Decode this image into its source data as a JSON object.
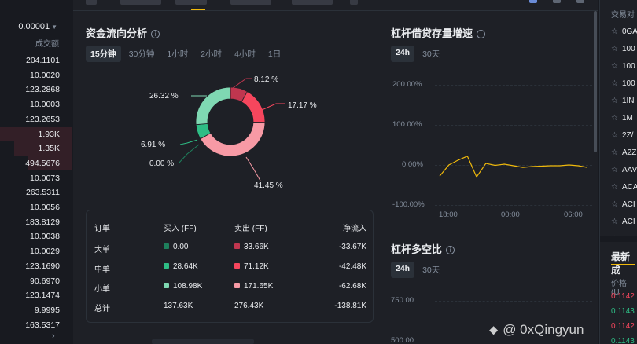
{
  "order_book": {
    "precision": "0.00001",
    "volume_label": "成交额",
    "rows": [
      "204.1101",
      "10.0020",
      "123.2868",
      "10.0003",
      "123.2653",
      "1.93K",
      "1.35K",
      "494.5676",
      "10.0073",
      "263.5311",
      "10.0056",
      "183.8129",
      "10.0038",
      "10.0029",
      "123.1690",
      "90.6970",
      "123.1474",
      "9.9995",
      "163.5317"
    ],
    "fill_fraction": [
      0.0,
      0.0,
      0.0,
      0.0,
      0.0,
      1.0,
      0.8,
      0.62,
      0.0,
      0.0,
      0.0,
      0.0,
      0.0,
      0.0,
      0.0,
      0.0,
      0.0,
      0.0,
      0.0
    ]
  },
  "fund_flow": {
    "title": "资金流向分析",
    "tabs": [
      "15分钟",
      "30分钟",
      "1小时",
      "2小时",
      "4小时",
      "1日"
    ],
    "active_tab": "15分钟",
    "donut_labels": {
      "left_top": "26.32 %",
      "top_right": "8.12 %",
      "right": "17.17 %",
      "left_mid": "6.91 %",
      "left_low": "0.00 %",
      "bottom_right": "41.45 %"
    },
    "segments": [
      {
        "name": "大单卖出",
        "value": 8.12,
        "color": "#c0364f"
      },
      {
        "name": "中单卖出",
        "value": 17.17,
        "color": "#f6465d"
      },
      {
        "name": "小单卖出",
        "value": 41.45,
        "color": "#f79aa5"
      },
      {
        "name": "大单买入",
        "value": 0.0,
        "color": "#1e7f5c"
      },
      {
        "name": "中单买入",
        "value": 6.91,
        "color": "#2ebd85"
      },
      {
        "name": "小单买入",
        "value": 26.32,
        "color": "#7fd8b2"
      }
    ],
    "table": {
      "headers": [
        "订单",
        "买入 (FF)",
        "卖出 (FF)",
        "净流入"
      ],
      "rows": [
        {
          "label": "大单",
          "buy": "0.00",
          "sell": "33.66K",
          "net": "-33.67K",
          "buy_color": "#1e7f5c",
          "sell_color": "#c0364f"
        },
        {
          "label": "中单",
          "buy": "28.64K",
          "sell": "71.12K",
          "net": "-42.48K",
          "buy_color": "#2ebd85",
          "sell_color": "#f6465d"
        },
        {
          "label": "小单",
          "buy": "108.98K",
          "sell": "171.65K",
          "net": "-62.68K",
          "buy_color": "#7fd8b2",
          "sell_color": "#f79aa5"
        },
        {
          "label": "总计",
          "buy": "137.63K",
          "sell": "276.43K",
          "net": "-138.81K"
        }
      ]
    }
  },
  "leverage_growth": {
    "title": "杠杆借贷存量增速",
    "tabs": [
      "24h",
      "30天"
    ],
    "active_tab": "24h",
    "y_ticks": [
      "200.00%",
      "100.00%",
      "0.00%",
      "-100.00%"
    ],
    "x_ticks": [
      "18:00",
      "00:00",
      "06:00"
    ]
  },
  "long_short": {
    "title": "杠杆多空比",
    "tabs": [
      "24h",
      "30天"
    ],
    "active_tab": "24h",
    "y_ticks": [
      "750.00",
      "500.00"
    ]
  },
  "chart_data": {
    "type": "line",
    "title": "杠杆借贷存量增速",
    "x_ticks": [
      "18:00",
      "00:00",
      "06:00"
    ],
    "ylim": [
      -100,
      200
    ],
    "y_ticks": [
      200,
      100,
      0,
      -100
    ],
    "values": [
      -28,
      0,
      12,
      22,
      -30,
      4,
      -1,
      2,
      -2,
      -6,
      -4,
      -3,
      -2,
      -2,
      0,
      -2,
      -6
    ],
    "line_color": "#f0b90b",
    "grid": true
  },
  "market_list": {
    "header": "交易对",
    "items": [
      "0GA",
      "100",
      "100",
      "100",
      "1IN",
      "1M",
      "2Z/",
      "A2Z",
      "AAV",
      "ACA",
      "ACI",
      "ACI",
      "ACI"
    ],
    "latest_title": "最新成",
    "price_label": "价格 (U",
    "prices": [
      {
        "value": "0.1142",
        "color": "#f6465d"
      },
      {
        "value": "0.1143",
        "color": "#2ebd85"
      },
      {
        "value": "0.1142",
        "color": "#f6465d"
      },
      {
        "value": "0.1143",
        "color": "#2ebd85"
      }
    ]
  },
  "watermark": {
    "text": "@ 0xQingyun"
  }
}
